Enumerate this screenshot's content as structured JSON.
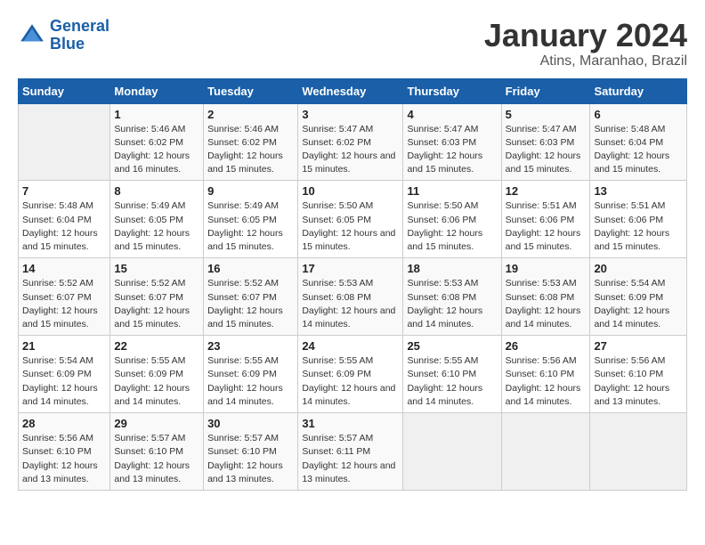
{
  "logo": {
    "line1": "General",
    "line2": "Blue"
  },
  "title": "January 2024",
  "subtitle": "Atins, Maranhao, Brazil",
  "days_of_week": [
    "Sunday",
    "Monday",
    "Tuesday",
    "Wednesday",
    "Thursday",
    "Friday",
    "Saturday"
  ],
  "weeks": [
    [
      {
        "day": "",
        "sunrise": "",
        "sunset": "",
        "daylight": ""
      },
      {
        "day": "1",
        "sunrise": "Sunrise: 5:46 AM",
        "sunset": "Sunset: 6:02 PM",
        "daylight": "Daylight: 12 hours and 16 minutes."
      },
      {
        "day": "2",
        "sunrise": "Sunrise: 5:46 AM",
        "sunset": "Sunset: 6:02 PM",
        "daylight": "Daylight: 12 hours and 15 minutes."
      },
      {
        "day": "3",
        "sunrise": "Sunrise: 5:47 AM",
        "sunset": "Sunset: 6:02 PM",
        "daylight": "Daylight: 12 hours and 15 minutes."
      },
      {
        "day": "4",
        "sunrise": "Sunrise: 5:47 AM",
        "sunset": "Sunset: 6:03 PM",
        "daylight": "Daylight: 12 hours and 15 minutes."
      },
      {
        "day": "5",
        "sunrise": "Sunrise: 5:47 AM",
        "sunset": "Sunset: 6:03 PM",
        "daylight": "Daylight: 12 hours and 15 minutes."
      },
      {
        "day": "6",
        "sunrise": "Sunrise: 5:48 AM",
        "sunset": "Sunset: 6:04 PM",
        "daylight": "Daylight: 12 hours and 15 minutes."
      }
    ],
    [
      {
        "day": "7",
        "sunrise": "Sunrise: 5:48 AM",
        "sunset": "Sunset: 6:04 PM",
        "daylight": "Daylight: 12 hours and 15 minutes."
      },
      {
        "day": "8",
        "sunrise": "Sunrise: 5:49 AM",
        "sunset": "Sunset: 6:05 PM",
        "daylight": "Daylight: 12 hours and 15 minutes."
      },
      {
        "day": "9",
        "sunrise": "Sunrise: 5:49 AM",
        "sunset": "Sunset: 6:05 PM",
        "daylight": "Daylight: 12 hours and 15 minutes."
      },
      {
        "day": "10",
        "sunrise": "Sunrise: 5:50 AM",
        "sunset": "Sunset: 6:05 PM",
        "daylight": "Daylight: 12 hours and 15 minutes."
      },
      {
        "day": "11",
        "sunrise": "Sunrise: 5:50 AM",
        "sunset": "Sunset: 6:06 PM",
        "daylight": "Daylight: 12 hours and 15 minutes."
      },
      {
        "day": "12",
        "sunrise": "Sunrise: 5:51 AM",
        "sunset": "Sunset: 6:06 PM",
        "daylight": "Daylight: 12 hours and 15 minutes."
      },
      {
        "day": "13",
        "sunrise": "Sunrise: 5:51 AM",
        "sunset": "Sunset: 6:06 PM",
        "daylight": "Daylight: 12 hours and 15 minutes."
      }
    ],
    [
      {
        "day": "14",
        "sunrise": "Sunrise: 5:52 AM",
        "sunset": "Sunset: 6:07 PM",
        "daylight": "Daylight: 12 hours and 15 minutes."
      },
      {
        "day": "15",
        "sunrise": "Sunrise: 5:52 AM",
        "sunset": "Sunset: 6:07 PM",
        "daylight": "Daylight: 12 hours and 15 minutes."
      },
      {
        "day": "16",
        "sunrise": "Sunrise: 5:52 AM",
        "sunset": "Sunset: 6:07 PM",
        "daylight": "Daylight: 12 hours and 15 minutes."
      },
      {
        "day": "17",
        "sunrise": "Sunrise: 5:53 AM",
        "sunset": "Sunset: 6:08 PM",
        "daylight": "Daylight: 12 hours and 14 minutes."
      },
      {
        "day": "18",
        "sunrise": "Sunrise: 5:53 AM",
        "sunset": "Sunset: 6:08 PM",
        "daylight": "Daylight: 12 hours and 14 minutes."
      },
      {
        "day": "19",
        "sunrise": "Sunrise: 5:53 AM",
        "sunset": "Sunset: 6:08 PM",
        "daylight": "Daylight: 12 hours and 14 minutes."
      },
      {
        "day": "20",
        "sunrise": "Sunrise: 5:54 AM",
        "sunset": "Sunset: 6:09 PM",
        "daylight": "Daylight: 12 hours and 14 minutes."
      }
    ],
    [
      {
        "day": "21",
        "sunrise": "Sunrise: 5:54 AM",
        "sunset": "Sunset: 6:09 PM",
        "daylight": "Daylight: 12 hours and 14 minutes."
      },
      {
        "day": "22",
        "sunrise": "Sunrise: 5:55 AM",
        "sunset": "Sunset: 6:09 PM",
        "daylight": "Daylight: 12 hours and 14 minutes."
      },
      {
        "day": "23",
        "sunrise": "Sunrise: 5:55 AM",
        "sunset": "Sunset: 6:09 PM",
        "daylight": "Daylight: 12 hours and 14 minutes."
      },
      {
        "day": "24",
        "sunrise": "Sunrise: 5:55 AM",
        "sunset": "Sunset: 6:09 PM",
        "daylight": "Daylight: 12 hours and 14 minutes."
      },
      {
        "day": "25",
        "sunrise": "Sunrise: 5:55 AM",
        "sunset": "Sunset: 6:10 PM",
        "daylight": "Daylight: 12 hours and 14 minutes."
      },
      {
        "day": "26",
        "sunrise": "Sunrise: 5:56 AM",
        "sunset": "Sunset: 6:10 PM",
        "daylight": "Daylight: 12 hours and 14 minutes."
      },
      {
        "day": "27",
        "sunrise": "Sunrise: 5:56 AM",
        "sunset": "Sunset: 6:10 PM",
        "daylight": "Daylight: 12 hours and 13 minutes."
      }
    ],
    [
      {
        "day": "28",
        "sunrise": "Sunrise: 5:56 AM",
        "sunset": "Sunset: 6:10 PM",
        "daylight": "Daylight: 12 hours and 13 minutes."
      },
      {
        "day": "29",
        "sunrise": "Sunrise: 5:57 AM",
        "sunset": "Sunset: 6:10 PM",
        "daylight": "Daylight: 12 hours and 13 minutes."
      },
      {
        "day": "30",
        "sunrise": "Sunrise: 5:57 AM",
        "sunset": "Sunset: 6:10 PM",
        "daylight": "Daylight: 12 hours and 13 minutes."
      },
      {
        "day": "31",
        "sunrise": "Sunrise: 5:57 AM",
        "sunset": "Sunset: 6:11 PM",
        "daylight": "Daylight: 12 hours and 13 minutes."
      },
      {
        "day": "",
        "sunrise": "",
        "sunset": "",
        "daylight": ""
      },
      {
        "day": "",
        "sunrise": "",
        "sunset": "",
        "daylight": ""
      },
      {
        "day": "",
        "sunrise": "",
        "sunset": "",
        "daylight": ""
      }
    ]
  ]
}
